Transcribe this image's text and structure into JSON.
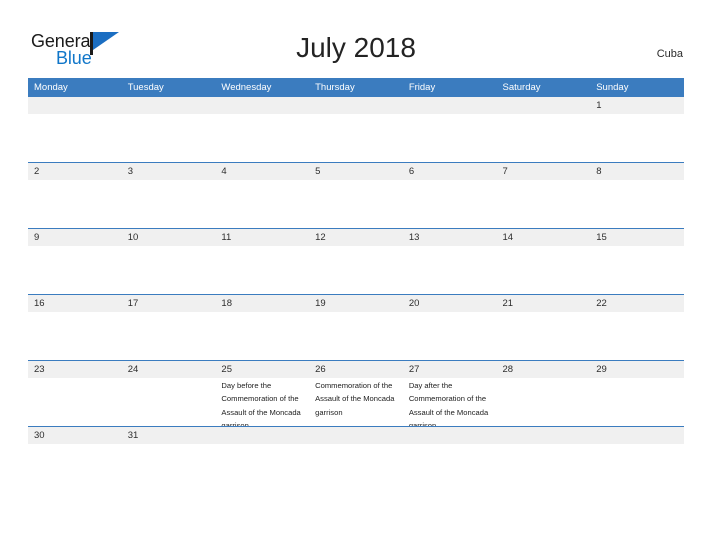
{
  "brand": {
    "name_part1": "General",
    "name_part2": "Blue",
    "mark": "flag-triangle-icon"
  },
  "header": {
    "title": "July 2018",
    "region": "Cuba"
  },
  "calendar": {
    "month": "July",
    "year": "2018",
    "weekday_headers": [
      "Monday",
      "Tuesday",
      "Wednesday",
      "Thursday",
      "Friday",
      "Saturday",
      "Sunday"
    ],
    "colors": {
      "header_blue": "#3b7cbf",
      "date_band_gray": "#f0f0f0",
      "separator_blue": "#3b7cbf",
      "brand_blue": "#1076c9",
      "brand_dark": "#1b1b1b"
    },
    "weeks": [
      {
        "days": [
          {
            "date": "",
            "event": ""
          },
          {
            "date": "",
            "event": ""
          },
          {
            "date": "",
            "event": ""
          },
          {
            "date": "",
            "event": ""
          },
          {
            "date": "",
            "event": ""
          },
          {
            "date": "",
            "event": ""
          },
          {
            "date": "1",
            "event": ""
          }
        ]
      },
      {
        "days": [
          {
            "date": "2",
            "event": ""
          },
          {
            "date": "3",
            "event": ""
          },
          {
            "date": "4",
            "event": ""
          },
          {
            "date": "5",
            "event": ""
          },
          {
            "date": "6",
            "event": ""
          },
          {
            "date": "7",
            "event": ""
          },
          {
            "date": "8",
            "event": ""
          }
        ]
      },
      {
        "days": [
          {
            "date": "9",
            "event": ""
          },
          {
            "date": "10",
            "event": ""
          },
          {
            "date": "11",
            "event": ""
          },
          {
            "date": "12",
            "event": ""
          },
          {
            "date": "13",
            "event": ""
          },
          {
            "date": "14",
            "event": ""
          },
          {
            "date": "15",
            "event": ""
          }
        ]
      },
      {
        "days": [
          {
            "date": "16",
            "event": ""
          },
          {
            "date": "17",
            "event": ""
          },
          {
            "date": "18",
            "event": ""
          },
          {
            "date": "19",
            "event": ""
          },
          {
            "date": "20",
            "event": ""
          },
          {
            "date": "21",
            "event": ""
          },
          {
            "date": "22",
            "event": ""
          }
        ]
      },
      {
        "days": [
          {
            "date": "23",
            "event": ""
          },
          {
            "date": "24",
            "event": ""
          },
          {
            "date": "25",
            "event": "Day before the Commemoration of the Assault of the Moncada garrison"
          },
          {
            "date": "26",
            "event": "Commemoration of the Assault of the Moncada garrison"
          },
          {
            "date": "27",
            "event": "Day after the Commemoration of the Assault of the Moncada garrison"
          },
          {
            "date": "28",
            "event": ""
          },
          {
            "date": "29",
            "event": ""
          }
        ]
      },
      {
        "days": [
          {
            "date": "30",
            "event": ""
          },
          {
            "date": "31",
            "event": ""
          },
          {
            "date": "",
            "event": ""
          },
          {
            "date": "",
            "event": ""
          },
          {
            "date": "",
            "event": ""
          },
          {
            "date": "",
            "event": ""
          },
          {
            "date": "",
            "event": ""
          }
        ]
      }
    ]
  }
}
